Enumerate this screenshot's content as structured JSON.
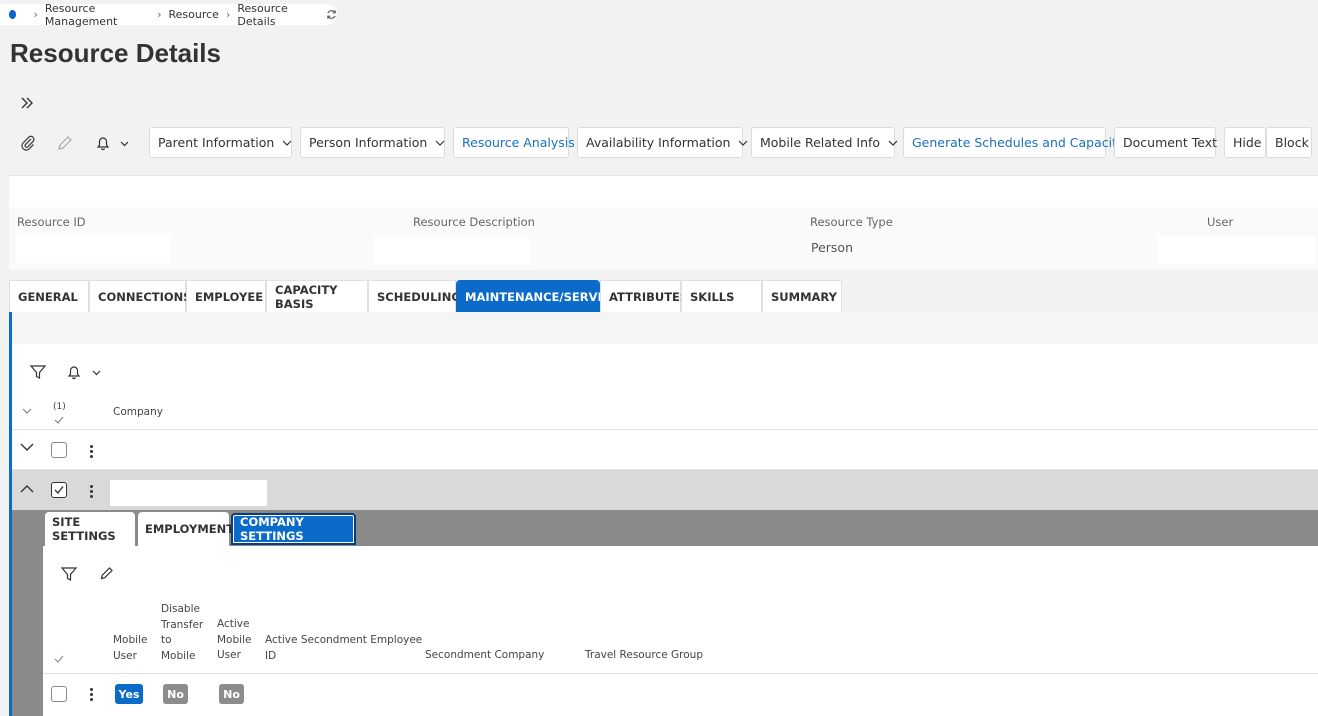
{
  "breadcrumb": {
    "items": [
      "Resource Management",
      "Resource",
      "Resource Details"
    ]
  },
  "page": {
    "title": "Resource Details"
  },
  "toolbar": {
    "buttons": [
      {
        "label": "Parent Information",
        "dropdown": true
      },
      {
        "label": "Person Information",
        "dropdown": true
      },
      {
        "label": "Resource Analysis",
        "dropdown": false
      },
      {
        "label": "Availability Information",
        "dropdown": true
      },
      {
        "label": "Mobile Related Info",
        "dropdown": true
      },
      {
        "label": "Generate Schedules and Capacity",
        "dropdown": false
      },
      {
        "label": "Document Text",
        "dropdown": false
      },
      {
        "label": "Hide",
        "dropdown": false
      },
      {
        "label": "Block",
        "dropdown": false
      }
    ]
  },
  "header": {
    "fields": [
      {
        "label": "Resource ID",
        "value": ""
      },
      {
        "label": "Resource Description",
        "value": ""
      },
      {
        "label": "Resource Type",
        "value": "Person"
      },
      {
        "label": "User",
        "value": ""
      }
    ]
  },
  "tabs": [
    {
      "label": "GENERAL"
    },
    {
      "label": "CONNECTIONS"
    },
    {
      "label": "EMPLOYEE"
    },
    {
      "label": "CAPACITY BASIS"
    },
    {
      "label": "SCHEDULING"
    },
    {
      "label": "MAINTENANCE/SERVICE",
      "active": true
    },
    {
      "label": "ATTRIBUTES"
    },
    {
      "label": "SKILLS"
    },
    {
      "label": "SUMMARY"
    }
  ],
  "grid": {
    "selected_count": "(1)",
    "columns": [
      "Company"
    ],
    "rows": [
      {
        "company": "",
        "checked": false,
        "expanded": false
      },
      {
        "company": "",
        "checked": true,
        "expanded": true
      }
    ]
  },
  "detail": {
    "subtabs": [
      {
        "label": "SITE SETTINGS"
      },
      {
        "label": "EMPLOYMENT"
      },
      {
        "label": "COMPANY SETTINGS",
        "active": true
      }
    ],
    "columns": {
      "mobile_user": [
        "Mobile",
        "User"
      ],
      "disable_transfer": [
        "Disable",
        "Transfer",
        "to",
        "Mobile"
      ],
      "active_mobile_user": [
        "Active",
        "Mobile",
        "User"
      ],
      "active_secondment": [
        "Active Secondment Employee",
        "ID"
      ],
      "secondment_company": "Secondment Company",
      "travel_resource_group": "Travel Resource Group"
    },
    "row": {
      "mobile_user": "Yes",
      "disable_transfer": "No",
      "active_mobile_user": "No"
    }
  },
  "colors": {
    "accent": "#0b6bc8",
    "pill_no": "#8c8c8c",
    "detail_bg": "#8a8a8a"
  }
}
